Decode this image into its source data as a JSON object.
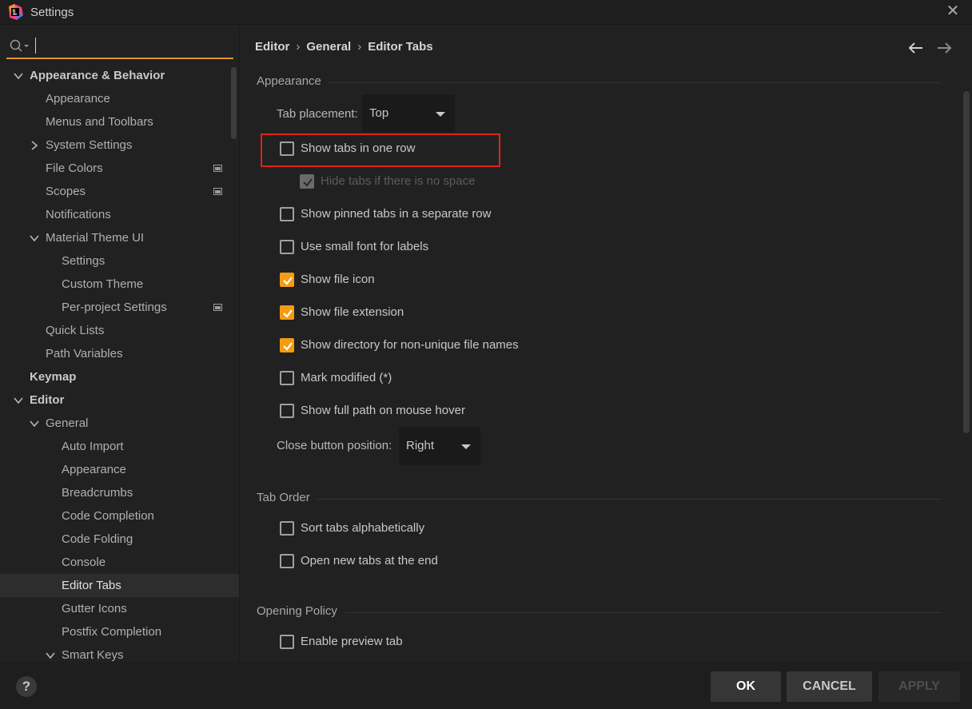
{
  "window": {
    "title": "Settings"
  },
  "search": {
    "placeholder": "",
    "value": ""
  },
  "sidebar": {
    "items": [
      {
        "label": "Appearance & Behavior",
        "bold": true,
        "arrow": "down",
        "level": 0
      },
      {
        "label": "Appearance",
        "level": 1
      },
      {
        "label": "Menus and Toolbars",
        "level": 1
      },
      {
        "label": "System Settings",
        "level": 1,
        "arrow": "right"
      },
      {
        "label": "File Colors",
        "level": 1,
        "project_icon": true
      },
      {
        "label": "Scopes",
        "level": 1,
        "project_icon": true
      },
      {
        "label": "Notifications",
        "level": 1
      },
      {
        "label": "Material Theme UI",
        "level": 1,
        "arrow": "down"
      },
      {
        "label": "Settings",
        "level": 2
      },
      {
        "label": "Custom Theme",
        "level": 2
      },
      {
        "label": "Per-project Settings",
        "level": 2,
        "project_icon": true
      },
      {
        "label": "Quick Lists",
        "level": 1
      },
      {
        "label": "Path Variables",
        "level": 1
      },
      {
        "label": "Keymap",
        "bold": true,
        "level": 0
      },
      {
        "label": "Editor",
        "bold": true,
        "arrow": "down",
        "level": 0
      },
      {
        "label": "General",
        "level": 1,
        "arrow": "down"
      },
      {
        "label": "Auto Import",
        "level": 2
      },
      {
        "label": "Appearance",
        "level": 2
      },
      {
        "label": "Breadcrumbs",
        "level": 2
      },
      {
        "label": "Code Completion",
        "level": 2
      },
      {
        "label": "Code Folding",
        "level": 2
      },
      {
        "label": "Console",
        "level": 2
      },
      {
        "label": "Editor Tabs",
        "level": 2,
        "selected": true
      },
      {
        "label": "Gutter Icons",
        "level": 2
      },
      {
        "label": "Postfix Completion",
        "level": 2
      },
      {
        "label": "Smart Keys",
        "level": 2,
        "arrow": "down"
      }
    ]
  },
  "breadcrumb": {
    "part1": "Editor",
    "part2": "General",
    "part3": "Editor Tabs",
    "separator": "›"
  },
  "sections": {
    "appearance": "Appearance",
    "tab_order": "Tab Order",
    "opening_policy": "Opening Policy"
  },
  "tab_placement": {
    "label": "Tab placement:",
    "value": "Top"
  },
  "close_button": {
    "label": "Close button position:",
    "value": "Right"
  },
  "options": {
    "show_tabs_one_row": {
      "label": "Show tabs in one row",
      "checked": false
    },
    "hide_tabs": {
      "label": "Hide tabs if there is no space",
      "checked": true,
      "disabled": true
    },
    "show_pinned": {
      "label": "Show pinned tabs in a separate row",
      "checked": false
    },
    "small_font": {
      "label": "Use small font for labels",
      "checked": false
    },
    "file_icon": {
      "label": "Show file icon",
      "checked": true
    },
    "file_extension": {
      "label": "Show file extension",
      "checked": true
    },
    "directory": {
      "label": "Show directory for non-unique file names",
      "checked": true
    },
    "mark_modified": {
      "label": "Mark modified (*)",
      "checked": false
    },
    "full_path": {
      "label": "Show full path on mouse hover",
      "checked": false
    },
    "sort_alpha": {
      "label": "Sort tabs alphabetically",
      "checked": false
    },
    "open_at_end": {
      "label": "Open new tabs at the end",
      "checked": false
    },
    "preview_tab": {
      "label": "Enable preview tab",
      "checked": false
    }
  },
  "footer": {
    "help": "?",
    "ok": "OK",
    "cancel": "CANCEL",
    "apply": "APPLY"
  },
  "colors": {
    "accent": "#f39c12",
    "search_underline": "#e8912d",
    "highlight": "#e0241f"
  }
}
